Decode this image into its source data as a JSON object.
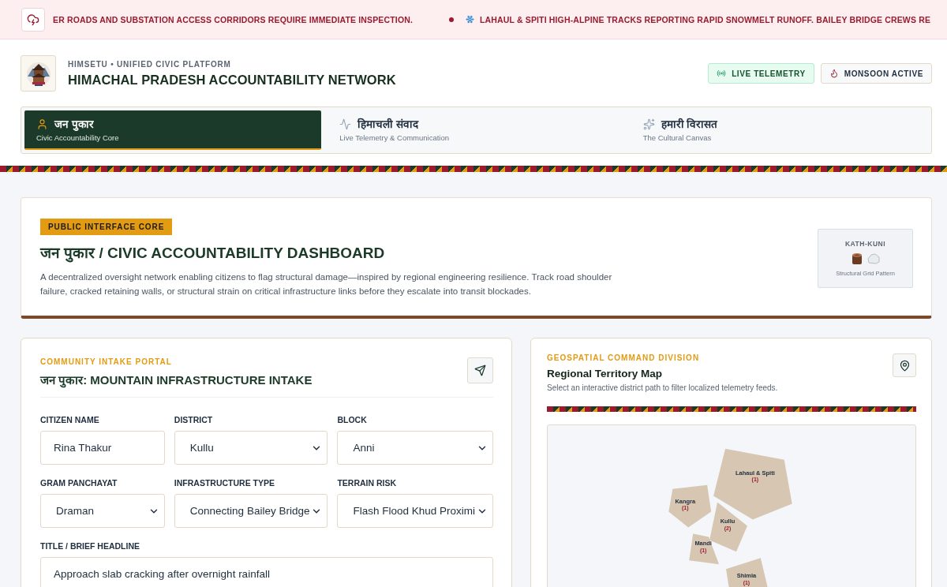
{
  "ticker": {
    "items": [
      {
        "kind": "plain",
        "text": "ER ROADS AND SUBSTATION ACCESS CORRIDORS REQUIRE IMMEDIATE INSPECTION."
      },
      {
        "kind": "snow",
        "text": "LAHAUL & SPITI HIGH-ALPINE TRACKS REPORTING RAPID SNOWMELT RUNOFF. BAILEY BRIDGE CREWS RE"
      }
    ]
  },
  "brand": {
    "eyebrow": "HIMSETU • UNIFIED CIVIC PLATFORM",
    "title": "HIMACHAL PRADESH ACCOUNTABILITY NETWORK"
  },
  "status_badges": [
    {
      "kind": "telemetry",
      "label": "LIVE TELEMETRY"
    },
    {
      "kind": "monsoon",
      "label": "MONSOON ACTIVE"
    }
  ],
  "tabs": [
    {
      "label": "जन पुकार",
      "subtitle": "Civic Accountability Core",
      "selected": true
    },
    {
      "label": "हिमाचली संवाद",
      "subtitle": "Live Telemetry & Communication",
      "selected": false
    },
    {
      "label": "हमारी विरासत",
      "subtitle": "The Cultural Canvas",
      "selected": false
    }
  ],
  "hero": {
    "badge": "PUBLIC INTERFACE CORE",
    "title": "जन पुकार / CIVIC ACCOUNTABILITY DASHBOARD",
    "description": "A decentralized oversight network enabling citizens to flag structural damage—inspired by regional engineering resilience. Track road shoulder failure, cracked retaining walls, or structural strain on critical infrastructure links before they escalate into transit blockades.",
    "pattern_card": {
      "title": "KATH-KUNI",
      "caption": "Structural Grid Pattern"
    }
  },
  "intake": {
    "eyebrow": "COMMUNITY INTAKE PORTAL",
    "title": "जन पुकार: MOUNTAIN INFRASTRUCTURE INTAKE",
    "fields": [
      {
        "kind": "text",
        "label": "CITIZEN NAME",
        "value": "Rina Thakur"
      },
      {
        "kind": "select",
        "label": "DISTRICT",
        "value": "Kullu"
      },
      {
        "kind": "select",
        "label": "BLOCK",
        "value": "Anni"
      },
      {
        "kind": "select",
        "label": "GRAM PANCHAYAT",
        "value": "Draman"
      },
      {
        "kind": "select",
        "label": "INFRASTRUCTURE TYPE",
        "value": "Connecting Bailey Bridge"
      },
      {
        "kind": "select",
        "label": "TERRAIN RISK",
        "value": "Flash Flood Khud Proximi"
      }
    ],
    "headline": {
      "label": "TITLE / BRIEF HEADLINE",
      "value": "Approach slab cracking after overnight rainfall"
    }
  },
  "map": {
    "eyebrow": "GEOSPATIAL COMMAND DIVISION",
    "title": "Regional Territory Map",
    "subtitle": "Select an interactive district path to filter localized telemetry feeds.",
    "districts": [
      {
        "name": "Lahaul & Spiti",
        "count": "(1)"
      },
      {
        "name": "Kangra",
        "count": "(1)"
      },
      {
        "name": "Kullu",
        "count": "(2)"
      },
      {
        "name": "Mandi",
        "count": "(1)"
      },
      {
        "name": "Shimla",
        "count": "(1)"
      }
    ]
  }
}
